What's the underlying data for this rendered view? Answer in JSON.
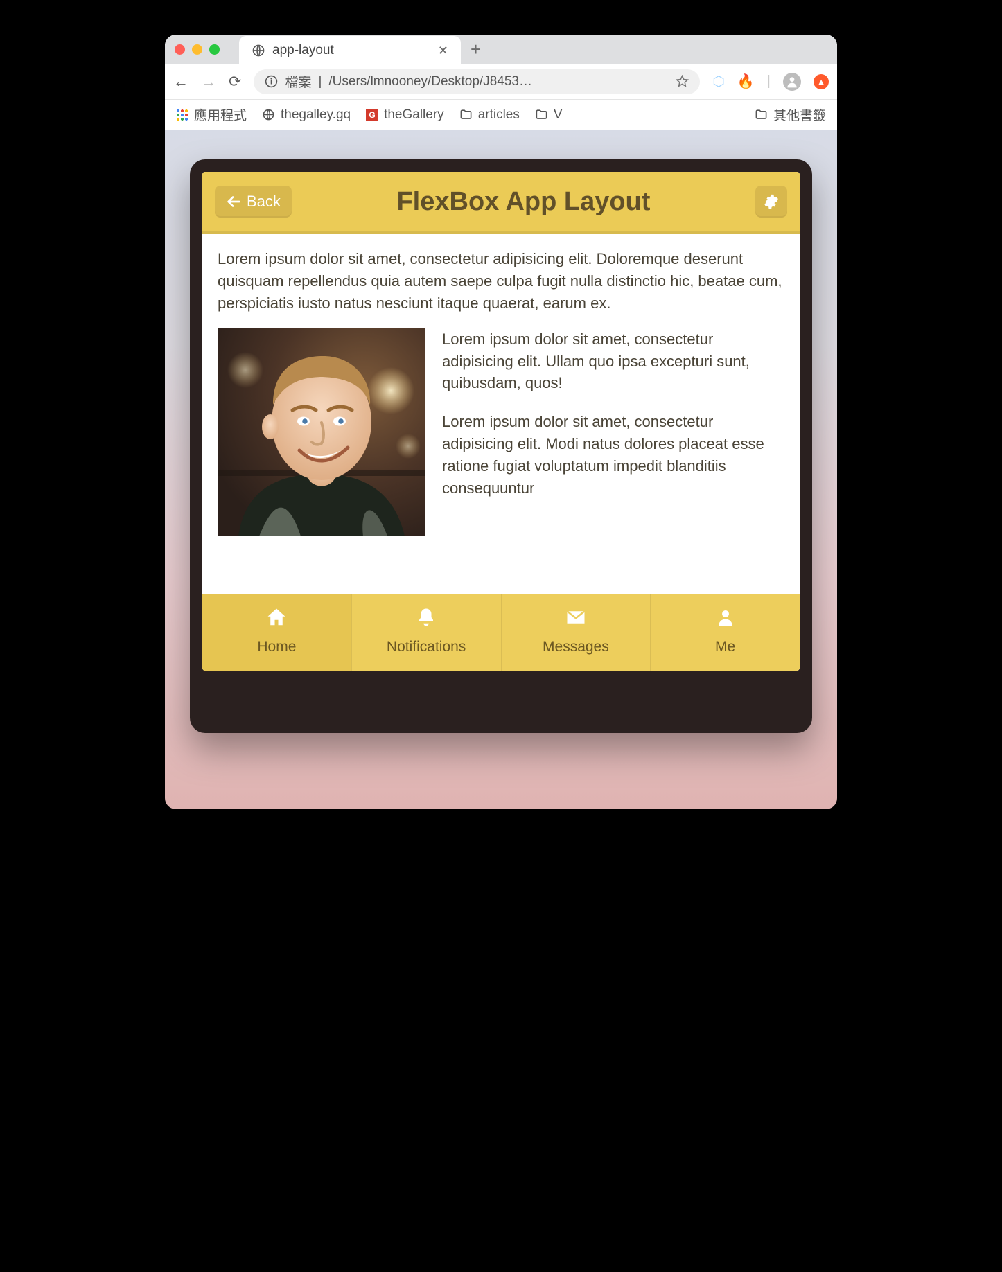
{
  "browser": {
    "tab_title": "app-layout",
    "url_scheme_label": "檔案",
    "url_path": "/Users/lmnooney/Desktop/J8453…",
    "bookmarks": {
      "apps": "應用程式",
      "items": [
        "thegalley.gq",
        "theGallery",
        "articles",
        "V"
      ],
      "other": "其他書籤"
    }
  },
  "app": {
    "header": {
      "back_label": "Back",
      "title": "FlexBox App Layout",
      "settings_icon": "gear"
    },
    "content": {
      "p1": "Lorem ipsum dolor sit amet, consectetur adipisicing elit. Doloremque deserunt quisquam repellendus quia autem saepe culpa fugit nulla distinctio hic, beatae cum, perspiciatis iusto natus nesciunt itaque quaerat, earum ex.",
      "p2": "Lorem ipsum dolor sit amet, consectetur adipisicing elit. Ullam quo ipsa excepturi sunt, quibusdam, quos!",
      "p3": "Lorem ipsum dolor sit amet, consectetur adipisicing elit. Modi natus dolores placeat esse ratione fugiat voluptatum impedit blanditiis consequuntur"
    },
    "nav": [
      {
        "icon": "home",
        "label": "Home",
        "active": true
      },
      {
        "icon": "bell",
        "label": "Notifications",
        "active": false
      },
      {
        "icon": "envelope",
        "label": "Messages",
        "active": false
      },
      {
        "icon": "user",
        "label": "Me",
        "active": false
      }
    ]
  },
  "colors": {
    "header_bg": "#ebcb56",
    "btn_bg": "#d8b84d",
    "nav_bg": "#edce5c",
    "text": "#615029"
  }
}
